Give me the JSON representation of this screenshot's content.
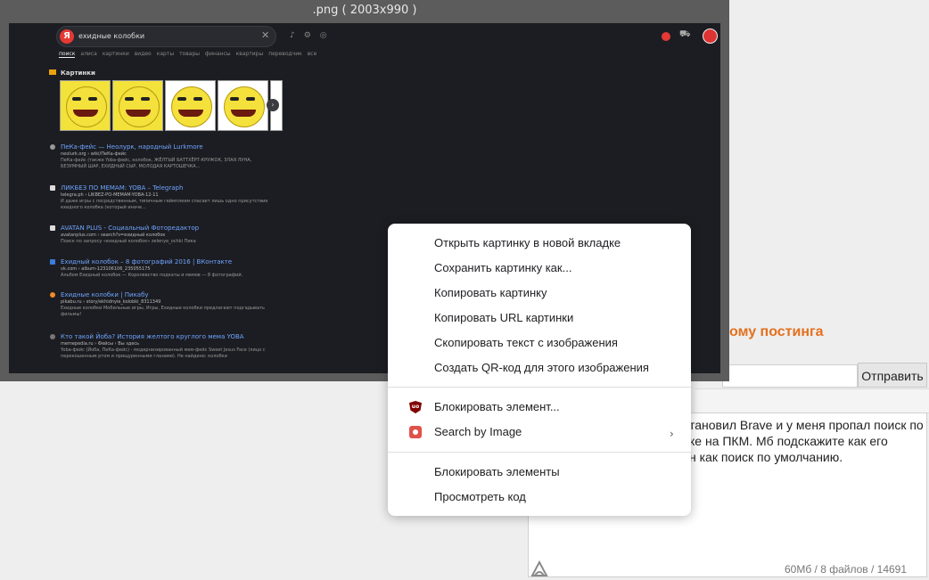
{
  "viewer": {
    "title": ".png ( 2003x990 )"
  },
  "yandex": {
    "logo": "Я",
    "query": "ехидные колобки",
    "tabs": [
      "поиск",
      "алиса",
      "картинки",
      "видео",
      "карты",
      "товары",
      "финансы",
      "квартиры",
      "переводчик",
      "все"
    ],
    "images_section": "Картинки",
    "results": [
      {
        "title": "ПеКа-фейс — Неолурк, народный Lurkmore",
        "url": "neolurk.org › wiki/ПеКа-фейс",
        "snippet": "ПеКа-фейс (также Yoba-фейс, колобок, ЖЁЛТЫЙ БАТТХЁРТ-КРУЖОК, ЗЛАЯ ЛУНА, БЕЗУМНЫЙ ШАР, ЕХИДНЫЙ СЫР, МОЛОДАЯ КАРТОШЕЧКА..."
      },
      {
        "title": "ЛИКБЕЗ ПО МЕМАМ: YOBA – Telegraph",
        "url": "telegra.ph › LIKBEZ-PO-MEMAM-YOBA-12-11",
        "snippet": "И даже игры с посредственным, типичным геймплеем спасает лишь одно присутствие ехидного колобка (который иначе..."
      },
      {
        "title": "AVATAN PLUS - Социальный Фоторедактор",
        "url": "avatanplus.com › search?s=ехидный колобок",
        "snippet": "Поиск по запросу «ехидный колобок» zelenye_ochki Пика"
      },
      {
        "title": "Ехидный колобок – 8 фотографий 2016 | ВКонтакте",
        "url": "vk.com › album-123106106_235055175",
        "snippet": "Альбом Ехидный колобок — Королевство подкаты и мемов — 8 фотографий."
      },
      {
        "title": "Ехидные колобки | Пикабу",
        "url": "pikabu.ru › story/ekhidnyie_kolobki_8311349",
        "snippet": "Ехидные колобки Мобильные игры, Игры, Ехидные колобки предлагают подгадывать фильмы!"
      },
      {
        "title": "Кто такой Йоба? История желтого круглого мема YOBA",
        "url": "memepedia.ru › Фейсы › Вы здесь",
        "snippet": "Yoba-фейс (Йоба, ПеКа-фейс) - модернизированный мем-фейс Sweet Jesus Face (лицо с перекошенным ртом и прищуренными глазами). Не найдено: колобки"
      }
    ]
  },
  "page": {
    "post_title_fragment": "ому постинга",
    "send_button": "Отправить",
    "comment_lines": [
      "тановил Brave и у меня пропал поиск по",
      "ке на ПКМ. Мб подскажите как его",
      "н как поиск по умолчанию."
    ],
    "footer_stats": "60Мб / 8 файлов / 14691"
  },
  "context_menu": {
    "items": [
      "Открыть картинку в новой вкладке",
      "Сохранить картинку как...",
      "Копировать картинку",
      "Копировать URL картинки",
      "Скопировать текст с изображения",
      "Создать QR-код для этого изображения",
      "Блокировать элемент...",
      "Search by Image",
      "Блокировать элементы",
      "Просмотреть код"
    ],
    "icons": {
      "block_element": "ublock-origin-icon",
      "search_by_image": "camera-icon"
    },
    "colors": {
      "ublock": "#800000",
      "camera": "#e0524a"
    }
  }
}
